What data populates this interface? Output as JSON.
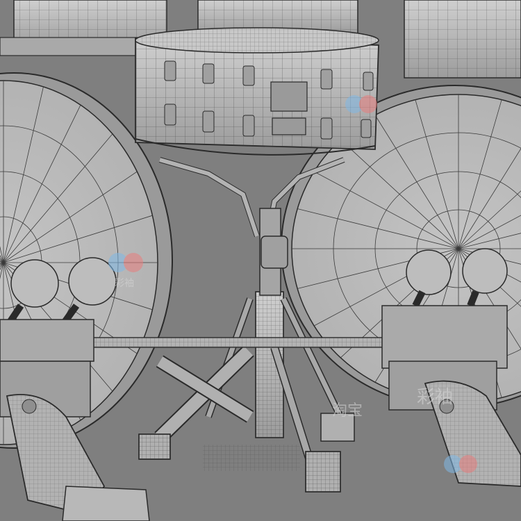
{
  "scene": {
    "description_icon": "drum-kit-wireframe-render",
    "background_color": "#7f7f7f",
    "line_color": "#2a2a2a",
    "surface_color": "#b8b8b8",
    "highlight_color": "#d4d4d4"
  },
  "watermarks": [
    {
      "text": "彩袖"
    },
    {
      "text": "淘宝"
    },
    {
      "text": "彩袖"
    }
  ]
}
